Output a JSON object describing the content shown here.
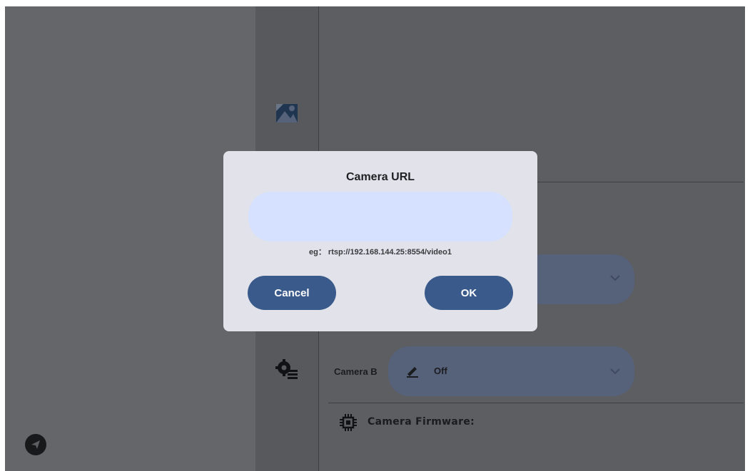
{
  "dialog": {
    "title": "Camera URL",
    "url_value": "",
    "hint": "eg： rtsp://192.168.144.25:8554/video1",
    "cancel_label": "Cancel",
    "ok_label": "OK"
  },
  "settings": {
    "camera_b_label": "Camera B",
    "camera_b_value": "Off",
    "firmware_label": "Camera Firmware:"
  },
  "icons": {
    "rail_top": "image-settings-icon",
    "rail_bottom": "gear-list-icon",
    "fab": "send-icon",
    "edit": "pencil-icon",
    "dropdown": "chevron-down-icon",
    "firmware": "chip-icon"
  },
  "colors": {
    "dialog_background": "#e2e3ea",
    "input_background": "#d5e1fe",
    "button": "#395a8a",
    "scrim": "#5d5e62"
  }
}
